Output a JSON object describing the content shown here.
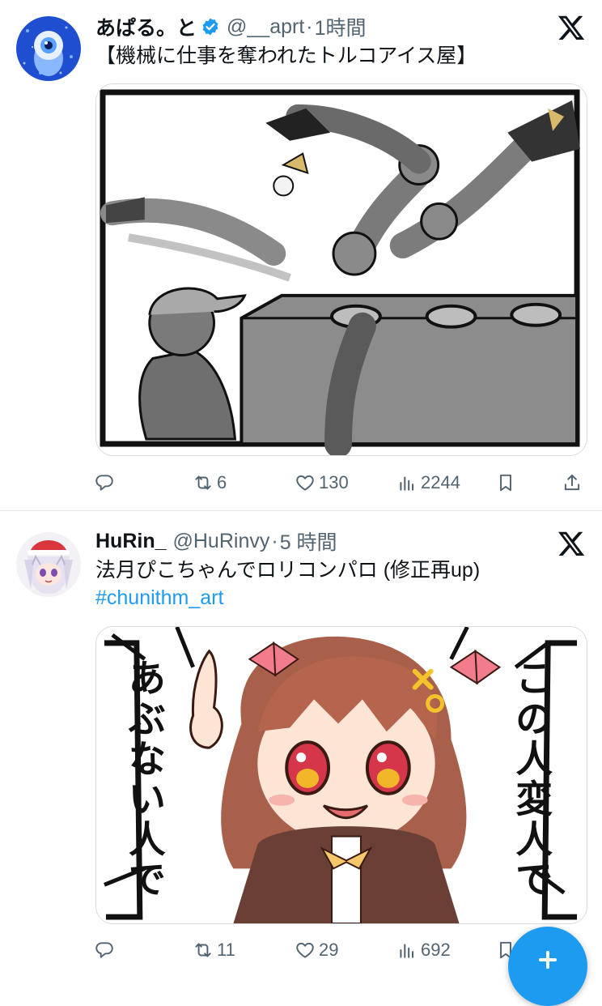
{
  "tweets": [
    {
      "name": "あぱる。と",
      "handle": "@__aprt",
      "separator": "·",
      "time": "1時間",
      "verified": true,
      "text": "【機械に仕事を奪われたトルコアイス屋】",
      "replies": "",
      "retweets": "6",
      "likes": "130",
      "views": "2244"
    },
    {
      "name": "HuRin_",
      "handle": "@HuRinvy",
      "separator": "·",
      "time": "5 時間",
      "verified": false,
      "text": "法月ぴこちゃんでロリコンパロ (修正再up)",
      "hashtag": "#chunithm_art",
      "replies": "",
      "retweets": "11",
      "likes": "29",
      "views": "692",
      "image_text": [
        "あぶない人です!",
        "この人変人です!"
      ]
    }
  ],
  "icons": {
    "verified": "verified-badge-icon",
    "platform": "x-logo-icon",
    "reply": "reply-icon",
    "retweet": "retweet-icon",
    "like": "heart-icon",
    "views": "views-icon",
    "bookmark": "bookmark-icon",
    "share": "share-icon",
    "compose": "plus-icon"
  },
  "colors": {
    "accent": "#1d9bf0",
    "secondary_text": "#536471",
    "divider": "#e6e9ec"
  }
}
